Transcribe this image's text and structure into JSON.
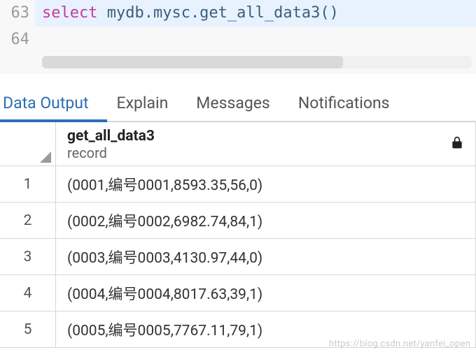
{
  "editor": {
    "lines": [
      {
        "num": "63",
        "tokens": [
          {
            "cls": "kw",
            "text": "select"
          },
          {
            "cls": "sp",
            "text": " "
          },
          {
            "cls": "ident",
            "text": "mydb.mysc.get_all_data3"
          },
          {
            "cls": "paren",
            "text": "()"
          }
        ]
      },
      {
        "num": "64",
        "tokens": []
      }
    ]
  },
  "tabs": {
    "items": [
      {
        "label": "Data Output",
        "active": true
      },
      {
        "label": "Explain",
        "active": false
      },
      {
        "label": "Messages",
        "active": false
      },
      {
        "label": "Notifications",
        "active": false
      }
    ]
  },
  "grid": {
    "column": {
      "name": "get_all_data3",
      "type": "record"
    },
    "rows": [
      {
        "n": "1",
        "v": "(0001,编号0001,8593.35,56,0)"
      },
      {
        "n": "2",
        "v": "(0002,编号0002,6982.74,84,1)"
      },
      {
        "n": "3",
        "v": "(0003,编号0003,4130.97,44,0)"
      },
      {
        "n": "4",
        "v": "(0004,编号0004,8017.63,39,1)"
      },
      {
        "n": "5",
        "v": "(0005,编号0005,7767.11,79,1)"
      }
    ]
  },
  "watermark": "https://blog.csdn.net/yanfei_open"
}
